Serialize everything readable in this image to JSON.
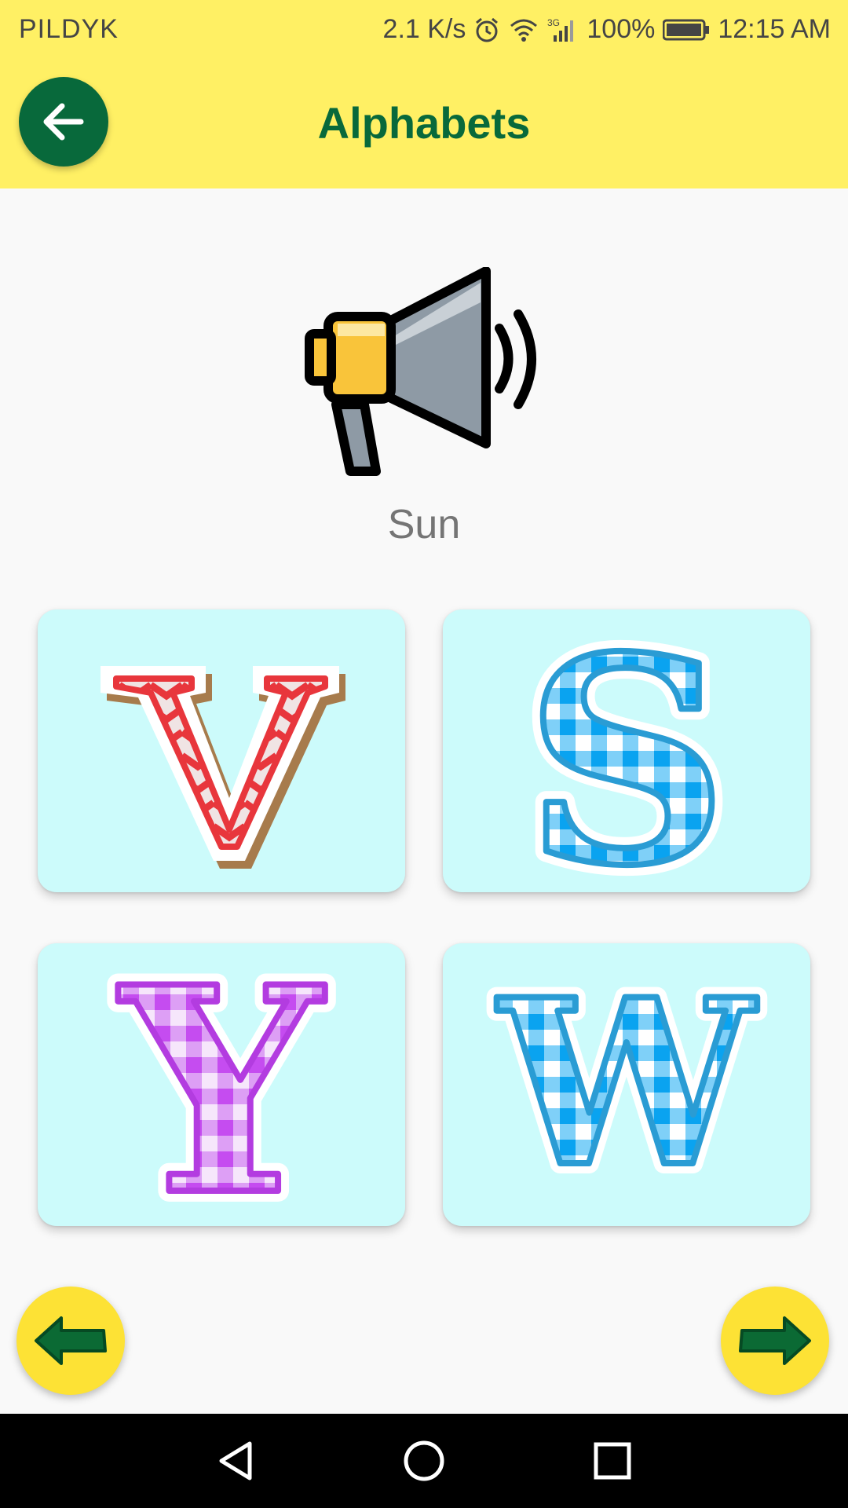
{
  "status_bar": {
    "carrier": "PILDYK",
    "speed": "2.1 K/s",
    "battery": "100%",
    "time": "12:15 AM"
  },
  "app_bar": {
    "title": "Alphabets"
  },
  "speaker": {
    "word": "Sun"
  },
  "cards": [
    {
      "letter": "V",
      "fill": "#e8363c",
      "pattern": "chevron"
    },
    {
      "letter": "S",
      "fill": "#2a9cd4",
      "pattern": "gingham"
    },
    {
      "letter": "Y",
      "fill": "#b33ce0",
      "pattern": "gingham"
    },
    {
      "letter": "W",
      "fill": "#2a9cd4",
      "pattern": "gingham"
    }
  ],
  "colors": {
    "header_bg": "#fff064",
    "primary_green": "#08693b",
    "card_bg": "#ccfbfb",
    "nav_button_bg": "#fde235"
  }
}
